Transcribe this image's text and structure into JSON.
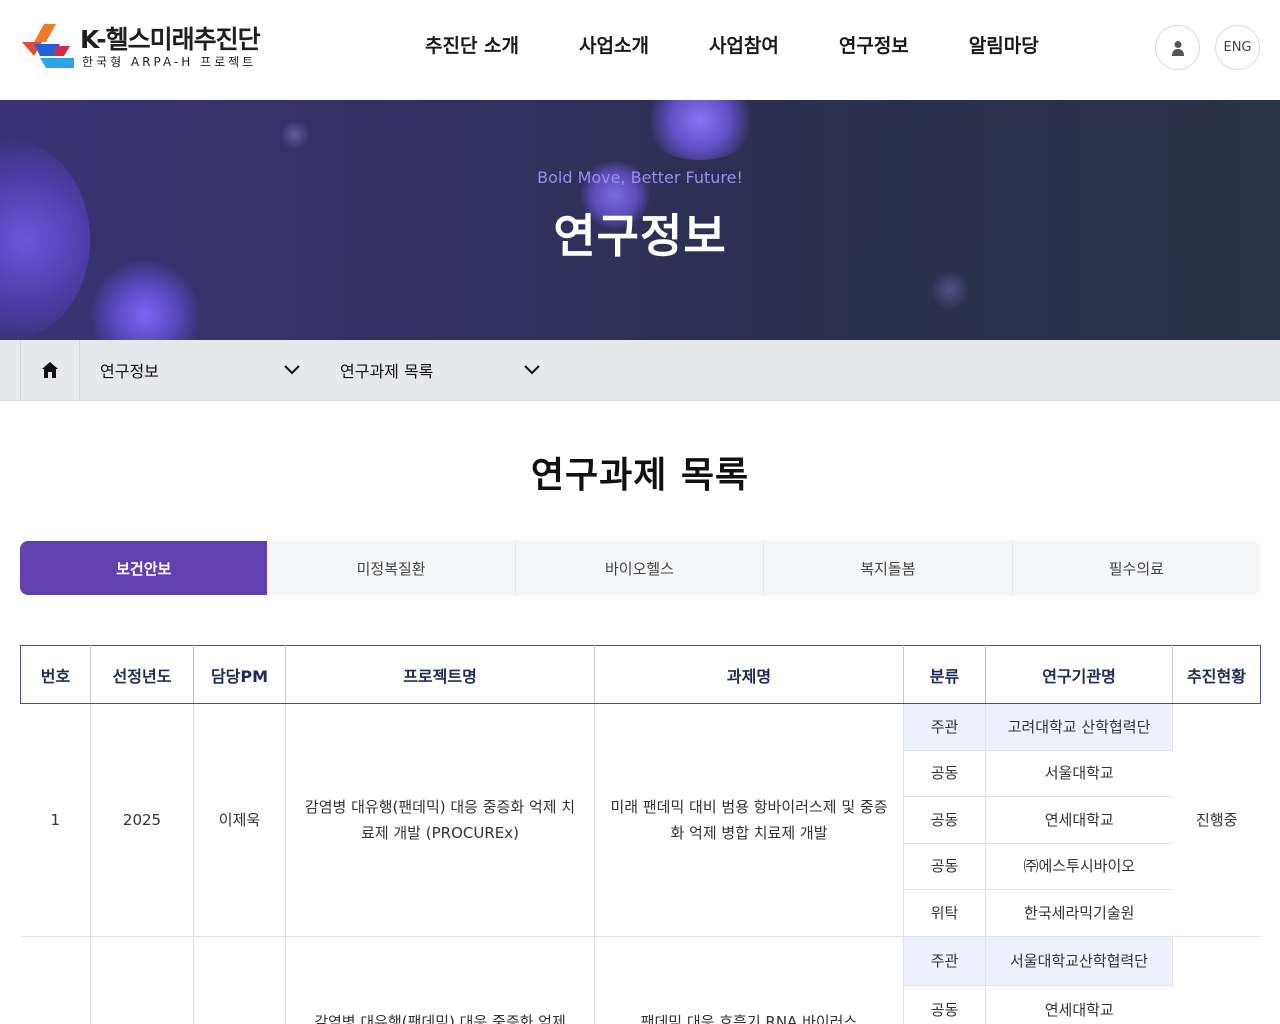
{
  "header": {
    "logo_title": "K-헬스미래추진단",
    "logo_sub": "한국형 ARPA-H 프로젝트",
    "nav": [
      "추진단 소개",
      "사업소개",
      "사업참여",
      "연구정보",
      "알림마당"
    ],
    "lang_label": "ENG"
  },
  "hero": {
    "subtitle": "Bold Move, Better Future!",
    "title": "연구정보"
  },
  "location": {
    "depth1": "연구정보",
    "depth2": "연구과제 목록"
  },
  "page_title": "연구과제 목록",
  "tabs": [
    "보건안보",
    "미정복질환",
    "바이오헬스",
    "복지돌봄",
    "필수의료"
  ],
  "table": {
    "headers": [
      "번호",
      "선정년도",
      "담당PM",
      "프로젝트명",
      "과제명",
      "분류",
      "연구기관명",
      "추진현황"
    ],
    "rows": [
      {
        "no": "1",
        "year": "2025",
        "pm": "이제욱",
        "project": "감염병 대유행(팬데믹) 대응 중증화 억제 치료제 개발 (PROCUREx)",
        "task": "미래 팬데믹 대비 범용 항바이러스제 및 중증화 억제 병합 치료제 개발",
        "status": "진행중",
        "orgs": [
          {
            "type": "주관",
            "name": "고려대학교 산학협력단"
          },
          {
            "type": "공동",
            "name": "서울대학교"
          },
          {
            "type": "공동",
            "name": "연세대학교"
          },
          {
            "type": "공동",
            "name": "㈜에스투시바이오"
          },
          {
            "type": "위탁",
            "name": "한국세라믹기술원"
          }
        ]
      },
      {
        "no": "",
        "year": "",
        "pm": "",
        "project": "감염병 대유행(팬데믹) 대응 중증화 억제",
        "task": "팬데믹 대응 호흡기 RNA 바이러스",
        "status": "",
        "orgs": [
          {
            "type": "주관",
            "name": "서울대학교산학협력단"
          },
          {
            "type": "공동",
            "name": "연세대학교"
          }
        ]
      }
    ]
  },
  "colors": {
    "accent": "#6041b0",
    "header_border": "#4a4e87",
    "main_org_bg": "#eef1fb"
  }
}
